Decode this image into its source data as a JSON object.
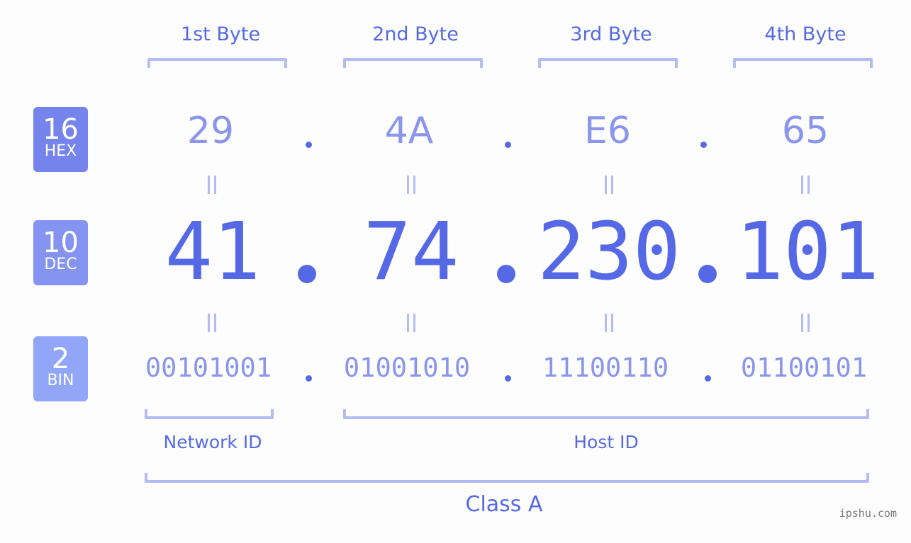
{
  "byte_headers": [
    "1st Byte",
    "2nd Byte",
    "3rd Byte",
    "4th Byte"
  ],
  "bases": [
    {
      "radix": "16",
      "name": "HEX",
      "color": "#7583ec"
    },
    {
      "radix": "10",
      "name": "DEC",
      "color": "#8593f1"
    },
    {
      "radix": "2",
      "name": "BIN",
      "color": "#92a6f8"
    }
  ],
  "hex": [
    "29",
    "4A",
    "E6",
    "65"
  ],
  "dec": [
    "41",
    "74",
    "230",
    "101"
  ],
  "bin": [
    "00101001",
    "01001010",
    "11100110",
    "01100101"
  ],
  "segments": {
    "network_id": "Network ID",
    "host_id": "Host ID",
    "class": "Class A"
  },
  "watermark": "ipshu.com",
  "colors": {
    "primary": "#5569e6",
    "light": "#8a95ee",
    "bracket": "#b3bcf6",
    "background": "#fcfdfc"
  }
}
